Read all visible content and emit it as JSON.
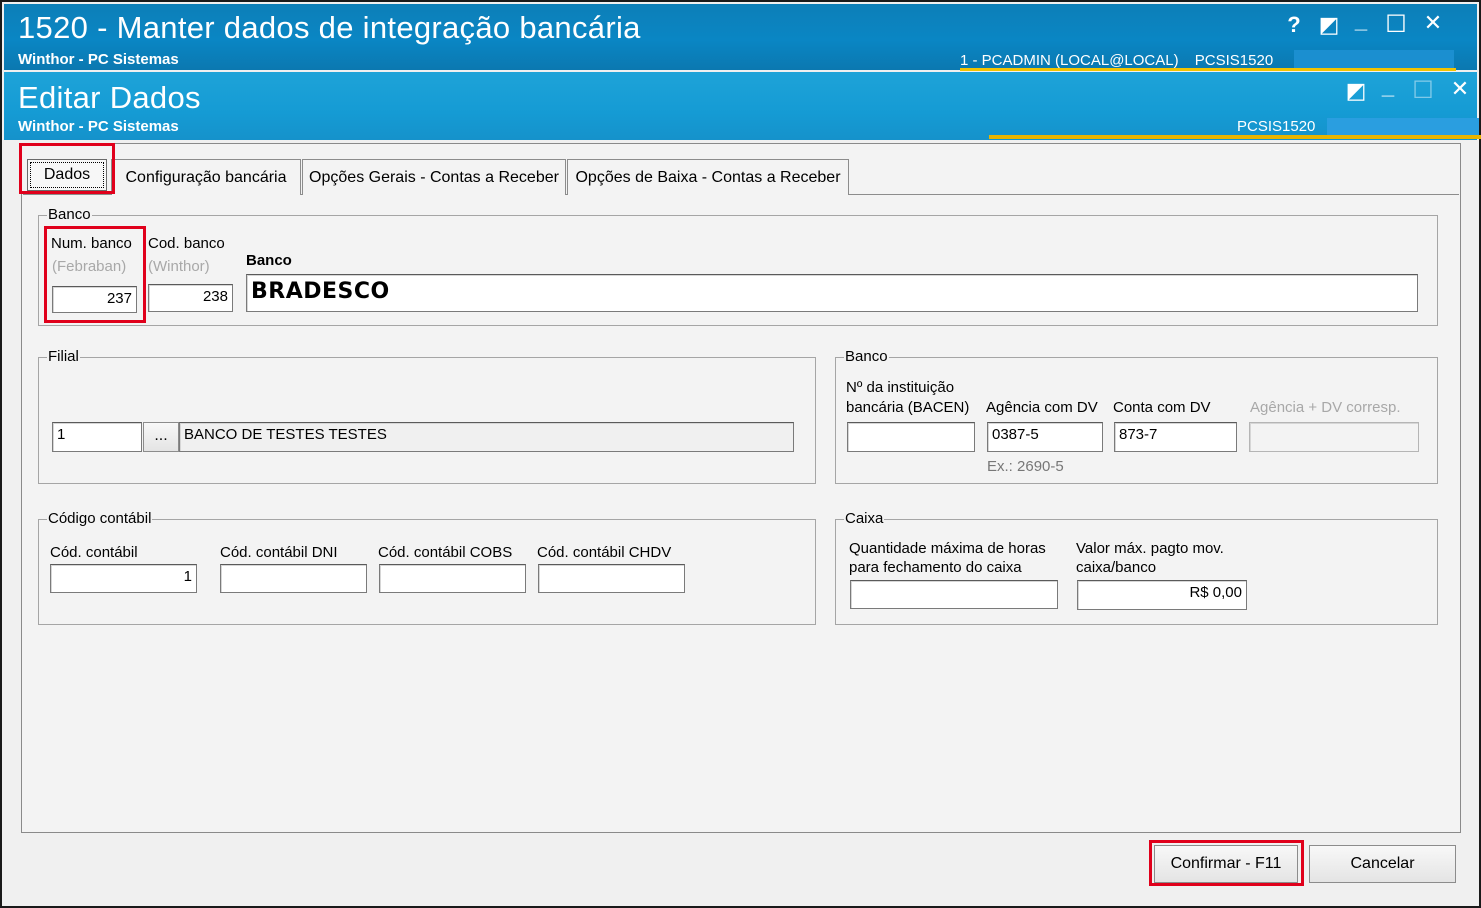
{
  "window": {
    "title": "1520 - Manter dados de integração bancária",
    "subtitle": "Winthor - PC Sistemas",
    "user_info": "1 - PCADMIN (LOCAL@LOCAL)",
    "program_code": "PCSIS1520",
    "help_glyph": "?",
    "restore_glyph": "◩",
    "minimize_glyph": "_",
    "maximize_glyph": "☐",
    "close_glyph": "✕"
  },
  "dialog": {
    "title": "Editar Dados",
    "subtitle": "Winthor - PC Sistemas",
    "program_code": "PCSIS1520"
  },
  "tabs": [
    {
      "label": "Dados"
    },
    {
      "label": "Configuração bancária"
    },
    {
      "label": "Opções Gerais - Contas a Receber"
    },
    {
      "label": "Opções de Baixa - Contas a Receber"
    }
  ],
  "banco_group": {
    "title": "Banco",
    "num_banco_label": "Num. banco",
    "num_banco_sub": "(Febraban)",
    "num_banco_value": "237",
    "cod_banco_label": "Cod. banco",
    "cod_banco_sub": "(Winthor)",
    "cod_banco_value": "238",
    "banco_label": "Banco",
    "banco_value": "BRADESCO"
  },
  "filial_group": {
    "title": "Filial",
    "code_value": "1",
    "lookup_label": "...",
    "name_value": "BANCO DE TESTES TESTES"
  },
  "banco2_group": {
    "title": "Banco",
    "bacen_label_1": "Nº da instituição",
    "bacen_label_2": "bancária (BACEN)",
    "bacen_value": "",
    "agencia_label": "Agência com DV",
    "agencia_value": "0387-5",
    "agencia_hint": "Ex.: 2690-5",
    "conta_label": "Conta com DV",
    "conta_value": "873-7",
    "agencia_corresp_label": "Agência + DV corresp.",
    "agencia_corresp_value": ""
  },
  "contabil_group": {
    "title": "Código contábil",
    "cod_contabil_label": "Cód. contábil",
    "cod_contabil_value": "1",
    "dni_label": "Cód. contábil DNI",
    "dni_value": "",
    "cobs_label": "Cód. contábil COBS",
    "cobs_value": "",
    "chdv_label": "Cód. contábil CHDV",
    "chdv_value": ""
  },
  "caixa_group": {
    "title": "Caixa",
    "horas_label_1": "Quantidade máxima de horas",
    "horas_label_2": "para fechamento do caixa",
    "horas_value": "",
    "valor_label_1": "Valor máx. pagto mov.",
    "valor_label_2": "caixa/banco",
    "valor_value": "R$ 0,00"
  },
  "footer": {
    "confirm_label": "Confirmar - F11",
    "cancel_label": "Cancelar"
  },
  "colors": {
    "titlebar": "#0a86c4",
    "highlight": "#e0001b"
  }
}
